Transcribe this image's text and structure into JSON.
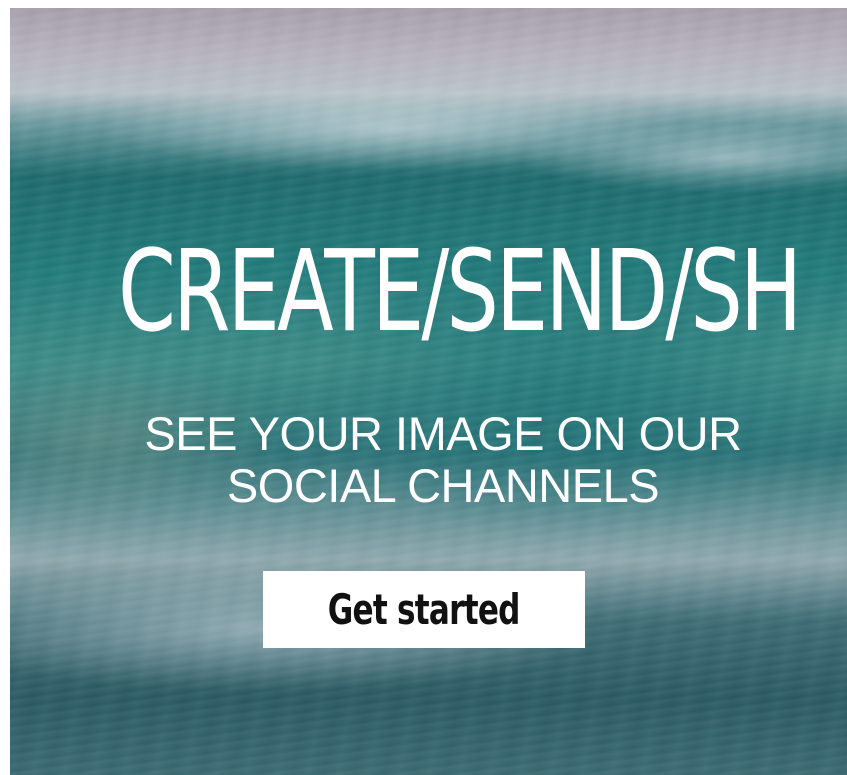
{
  "hero": {
    "background": "ocean-wave-photo",
    "headline": "CREATE/SEND/SH",
    "subheadline": "SEE YOUR IMAGE ON OUR SOCIAL CHANNELS",
    "cta_label": "Get started"
  },
  "colors": {
    "text": "#ffffff",
    "button_bg": "#ffffff",
    "button_text": "#111111",
    "wave_teal": "#1e6a6d"
  }
}
